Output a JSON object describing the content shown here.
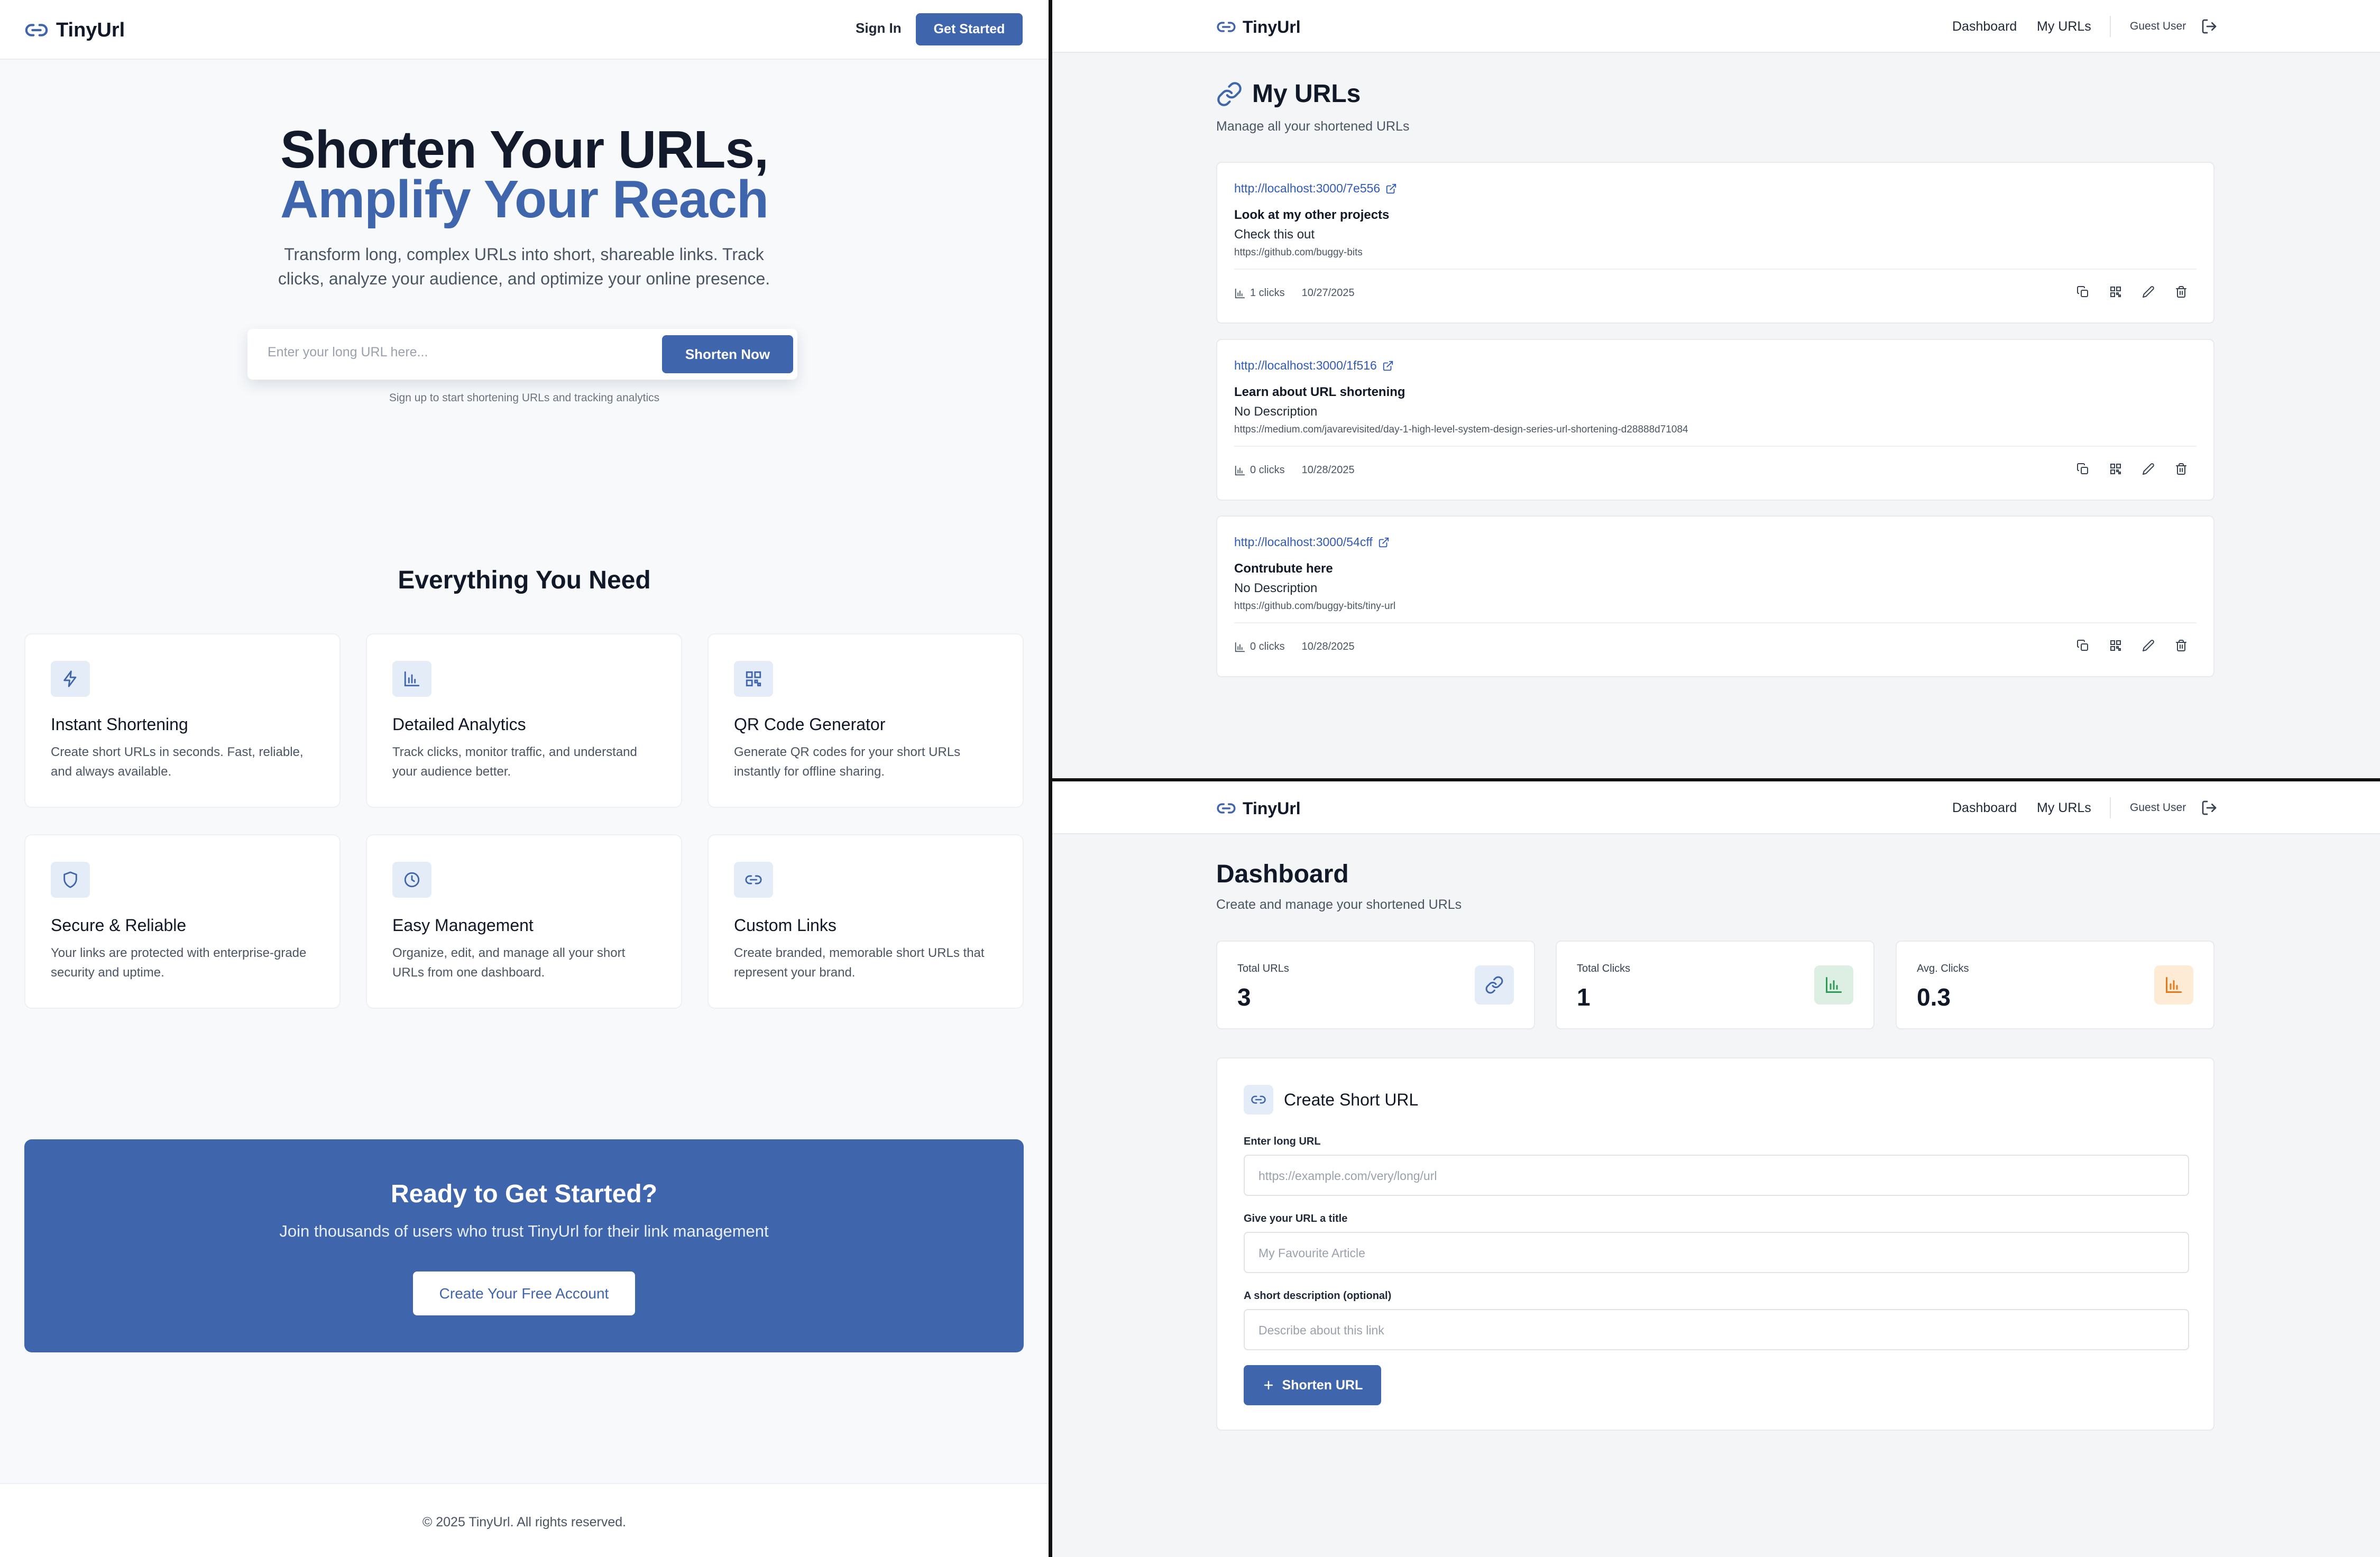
{
  "colors": {
    "brand": "#3f65ad",
    "link": "#2f5bb4",
    "icon_bg": "#e4ecf8",
    "green_bg": "#dcefe2",
    "green": "#2f9b56",
    "orange_bg": "#fdebd6",
    "orange": "#e8791b"
  },
  "landing": {
    "header": {
      "logo": "TinyUrl",
      "signin": "Sign In",
      "get_started": "Get Started"
    },
    "hero": {
      "title_line1": "Shorten Your URLs,",
      "title_line2": "Amplify Your Reach",
      "subtitle": "Transform long, complex URLs into short, shareable links. Track clicks, analyze your audience, and optimize your online presence.",
      "input_placeholder": "Enter your long URL here...",
      "button": "Shorten Now",
      "note": "Sign up to start shortening URLs and tracking analytics"
    },
    "features": {
      "title": "Everything You Need",
      "items": [
        {
          "icon": "lightning-icon",
          "title": "Instant Shortening",
          "desc": "Create short URLs in seconds. Fast, reliable, and always available."
        },
        {
          "icon": "bar-chart-icon",
          "title": "Detailed Analytics",
          "desc": "Track clicks, monitor traffic, and understand your audience better."
        },
        {
          "icon": "qr-code-icon",
          "title": "QR Code Generator",
          "desc": "Generate QR codes for your short URLs instantly for offline sharing."
        },
        {
          "icon": "shield-icon",
          "title": "Secure & Reliable",
          "desc": "Your links are protected with enterprise-grade security and uptime."
        },
        {
          "icon": "clock-icon",
          "title": "Easy Management",
          "desc": "Organize, edit, and manage all your short URLs from one dashboard."
        },
        {
          "icon": "link-icon",
          "title": "Custom Links",
          "desc": "Create branded, memorable short URLs that represent your brand."
        }
      ]
    },
    "cta": {
      "title": "Ready to Get Started?",
      "subtitle": "Join thousands of users who trust TinyUrl for their link management",
      "button": "Create Your Free Account"
    },
    "footer": "© 2025 TinyUrl. All rights reserved."
  },
  "app_header": {
    "logo": "TinyUrl",
    "nav_dashboard": "Dashboard",
    "nav_myurls": "My URLs",
    "user": "Guest User"
  },
  "myurls": {
    "title": "My URLs",
    "subtitle": "Manage all your shortened URLs",
    "urls": [
      {
        "short": "http://localhost:3000/7e556",
        "title": "Look at my other projects",
        "desc": "Check this out",
        "long": "https://github.com/buggy-bits",
        "clicks": "1 clicks",
        "date": "10/27/2025"
      },
      {
        "short": "http://localhost:3000/1f516",
        "title": "Learn about URL shortening",
        "desc": "No Description",
        "long": "https://medium.com/javarevisited/day-1-high-level-system-design-series-url-shortening-d28888d71084",
        "clicks": "0 clicks",
        "date": "10/28/2025"
      },
      {
        "short": "http://localhost:3000/54cff",
        "title": "Contrubute here",
        "desc": "No Description",
        "long": "https://github.com/buggy-bits/tiny-url",
        "clicks": "0 clicks",
        "date": "10/28/2025"
      }
    ]
  },
  "dashboard": {
    "title": "Dashboard",
    "subtitle": "Create and manage your shortened URLs",
    "stats": [
      {
        "label": "Total URLs",
        "value": "3",
        "icon": "link-icon"
      },
      {
        "label": "Total Clicks",
        "value": "1",
        "icon": "bar-chart-icon"
      },
      {
        "label": "Avg. Clicks",
        "value": "0.3",
        "icon": "bar-chart-icon"
      }
    ],
    "create": {
      "title": "Create Short URL",
      "long_label": "Enter long URL",
      "long_placeholder": "https://example.com/very/long/url",
      "title_label": "Give your URL a title",
      "title_placeholder": "My Favourite Article",
      "desc_label": "A short description (optional)",
      "desc_placeholder": "Describe about this link",
      "button": "Shorten URL"
    }
  }
}
